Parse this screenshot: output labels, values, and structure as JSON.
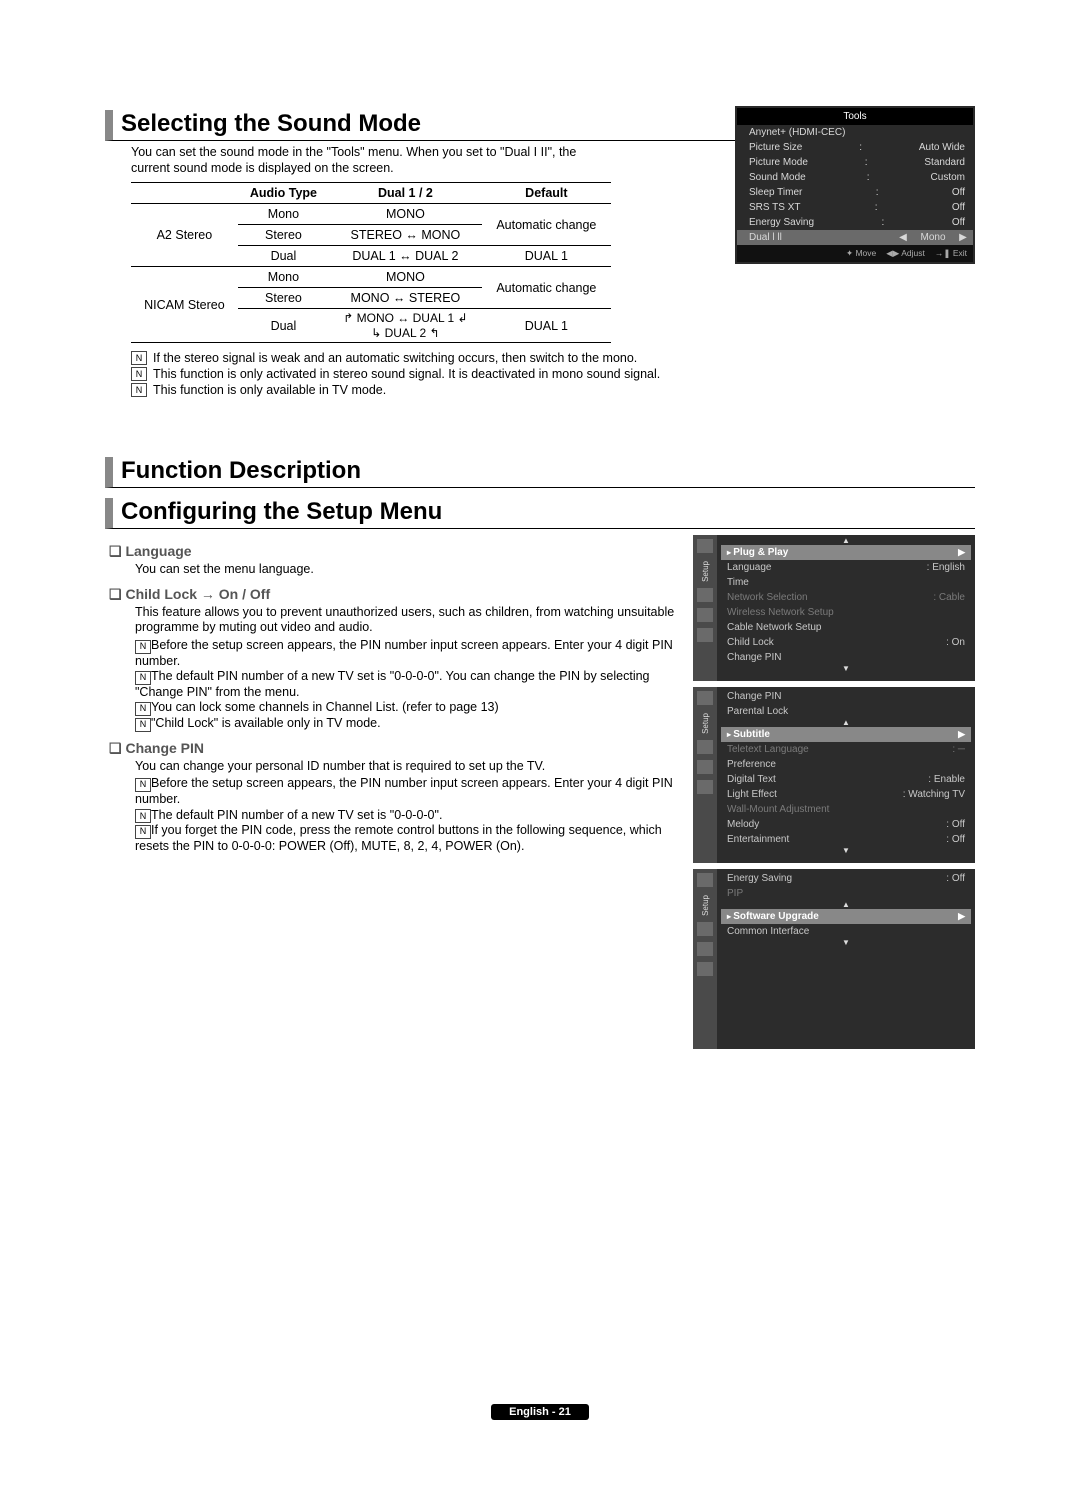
{
  "section1": {
    "title": "Selecting the Sound Mode",
    "intro": "You can set the sound mode in the \"Tools\" menu. When you set to \"Dual I II\", the current sound mode is displayed on the screen.",
    "table": {
      "headers": [
        "Audio Type",
        "Dual 1 / 2",
        "Default"
      ],
      "group1_label": "A2 Stereo",
      "group2_label": "NICAM Stereo",
      "r1": {
        "a": "Mono",
        "b": "MONO",
        "c_span": "Automatic change"
      },
      "r2": {
        "a": "Stereo",
        "b": "STEREO ↔ MONO"
      },
      "r3": {
        "a": "Dual",
        "b": "DUAL 1 ↔ DUAL 2",
        "c": "DUAL 1"
      },
      "r4": {
        "a": "Mono",
        "b": "MONO",
        "c_span": "Automatic change"
      },
      "r5": {
        "a": "Stereo",
        "b": "MONO ↔ STEREO"
      },
      "r6": {
        "a": "Dual",
        "b_l1": "MONO ↔ DUAL 1",
        "b_l2": "DUAL 2",
        "c": "DUAL 1"
      }
    },
    "notes": [
      "If the stereo signal is weak and an automatic switching occurs, then switch to the mono.",
      "This function is only activated in stereo sound signal. It is deactivated in mono sound signal.",
      "This function is only available in TV mode."
    ]
  },
  "tools_osd": {
    "title": "Tools",
    "anynet": "Anynet+ (HDMI-CEC)",
    "rows": [
      {
        "l": "Picture Size",
        "v": "Auto Wide"
      },
      {
        "l": "Picture Mode",
        "v": "Standard"
      },
      {
        "l": "Sound Mode",
        "v": "Custom"
      },
      {
        "l": "Sleep Timer",
        "v": "Off"
      },
      {
        "l": "SRS TS XT",
        "v": "Off"
      },
      {
        "l": "Energy Saving",
        "v": "Off"
      }
    ],
    "highlight": {
      "l": "Dual l ll",
      "v": "Mono"
    },
    "footer": {
      "move": "Move",
      "adjust": "Adjust",
      "exit": "Exit"
    }
  },
  "section2": {
    "title1": "Function Description",
    "title2": "Configuring the Setup Menu",
    "language": {
      "h": "Language",
      "d": "You can set the menu language."
    },
    "childlock": {
      "h": "Child Lock → On / Off",
      "d": "This feature allows you to prevent unauthorized users, such as children, from watching unsuitable programme by muting out video and audio.",
      "notes": [
        "Before the setup screen appears, the PIN number input screen appears. Enter your 4 digit PIN number.",
        "The default PIN number of a new TV set is \"0-0-0-0\". You can change the PIN by selecting \"Change PIN\" from the menu.",
        "You can lock some channels in Channel List. (refer to page 13)",
        "\"Child Lock\" is available only in TV mode."
      ]
    },
    "changepin": {
      "h": "Change PIN",
      "d": "You can change your personal ID number that is required to set up the TV.",
      "notes": [
        "Before the setup screen appears, the PIN number input screen appears. Enter your 4 digit PIN number.",
        "The default PIN number of a new TV set is \"0-0-0-0\".",
        "If you forget the PIN code, press the remote control buttons in the following sequence, which resets the PIN to 0-0-0-0: POWER (Off), MUTE, 8, 2, 4, POWER (On)."
      ]
    }
  },
  "setup_osd": [
    {
      "rail": "Setup",
      "highlight": "Plug & Play",
      "items": [
        {
          "l": "Language",
          "v": ": English"
        },
        {
          "l": "Time",
          "v": ""
        },
        {
          "l": "Network Selection",
          "v": ": Cable",
          "dim": true
        },
        {
          "l": "Wireless Network Setup",
          "v": "",
          "dim": true
        },
        {
          "l": "Cable Network Setup",
          "v": ""
        },
        {
          "l": "Child Lock",
          "v": ": On"
        },
        {
          "l": "Change PIN",
          "v": ""
        }
      ]
    },
    {
      "rail": "Setup",
      "pre": [
        {
          "l": "Change PIN",
          "v": ""
        },
        {
          "l": "Parental Lock",
          "v": ""
        }
      ],
      "highlight": "Subtitle",
      "items": [
        {
          "l": "Teletext Language",
          "v": ": ─",
          "dim": true
        },
        {
          "l": "Preference",
          "v": ""
        },
        {
          "l": "Digital Text",
          "v": ": Enable"
        },
        {
          "l": "Light Effect",
          "v": ": Watching TV"
        },
        {
          "l": "Wall-Mount Adjustment",
          "v": "",
          "dim": true
        },
        {
          "l": "Melody",
          "v": ": Off"
        },
        {
          "l": "Entertainment",
          "v": ": Off"
        }
      ]
    },
    {
      "rail": "Setup",
      "pre": [
        {
          "l": "Energy Saving",
          "v": ": Off"
        },
        {
          "l": "PIP",
          "v": "",
          "dim": true
        }
      ],
      "highlight": "Software Upgrade",
      "items": [
        {
          "l": "Common Interface",
          "v": ""
        }
      ],
      "big": true
    }
  ],
  "footer": "English - 21",
  "note_icon": "N"
}
